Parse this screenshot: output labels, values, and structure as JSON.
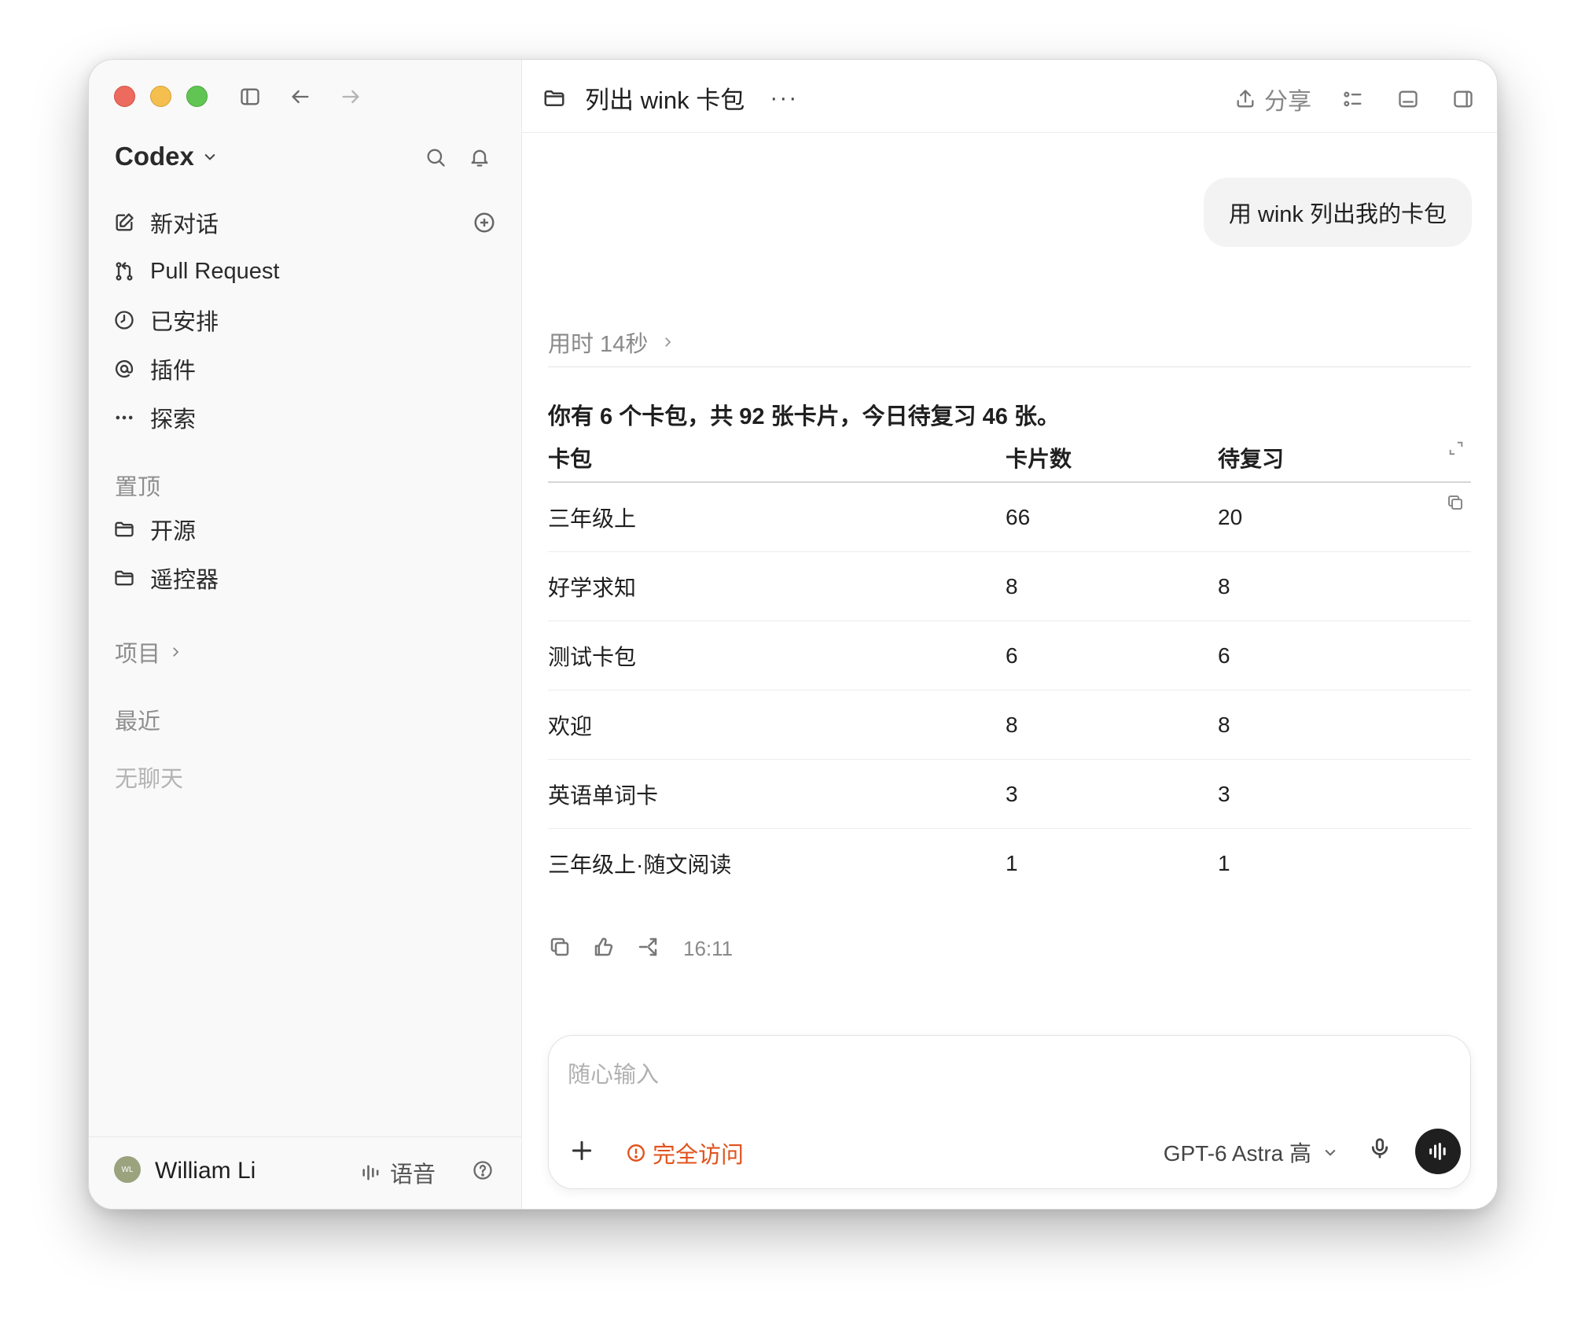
{
  "sidebar": {
    "app_name": "Codex",
    "nav": [
      {
        "label": "新对话",
        "icon": "edit-icon"
      },
      {
        "label": "Pull Request",
        "icon": "git-pull-request-icon"
      },
      {
        "label": "已安排",
        "icon": "clock-icon"
      },
      {
        "label": "插件",
        "icon": "at-sign-icon"
      },
      {
        "label": "探索",
        "icon": "ellipsis-icon"
      }
    ],
    "pinned_label": "置顶",
    "pinned": [
      {
        "label": "开源",
        "icon": "folder-icon"
      },
      {
        "label": "遥控器",
        "icon": "folder-icon"
      }
    ],
    "projects_label": "项目",
    "recent_label": "最近",
    "recent_empty": "无聊天",
    "user": {
      "initials": "WL",
      "name": "William Li"
    },
    "voice_label": "语音"
  },
  "main": {
    "title": "列出 wink 卡包",
    "more": "···",
    "share_label": "分享",
    "user_message": "用 wink 列出我的卡包",
    "thinking_label": "用时 14秒",
    "summary": "你有 6 个卡包，共 92 张卡片，今日待复习 46 张。",
    "table": {
      "headers": [
        "卡包",
        "卡片数",
        "待复习"
      ],
      "rows": [
        [
          "三年级上",
          "66",
          "20"
        ],
        [
          "好学求知",
          "8",
          "8"
        ],
        [
          "测试卡包",
          "6",
          "6"
        ],
        [
          "欢迎",
          "8",
          "8"
        ],
        [
          "英语单词卡",
          "3",
          "3"
        ],
        [
          "三年级上·随文阅读",
          "1",
          "1"
        ]
      ]
    },
    "message_time": "16:11",
    "composer": {
      "placeholder": "随心输入",
      "access_label": "完全访问",
      "model_label": "GPT-6 Astra 高"
    }
  },
  "colors": {
    "accent_warning": "#e0531d",
    "traffic_red": "#ed6a5e",
    "traffic_yellow": "#f5bf4f",
    "traffic_green": "#61c554"
  }
}
